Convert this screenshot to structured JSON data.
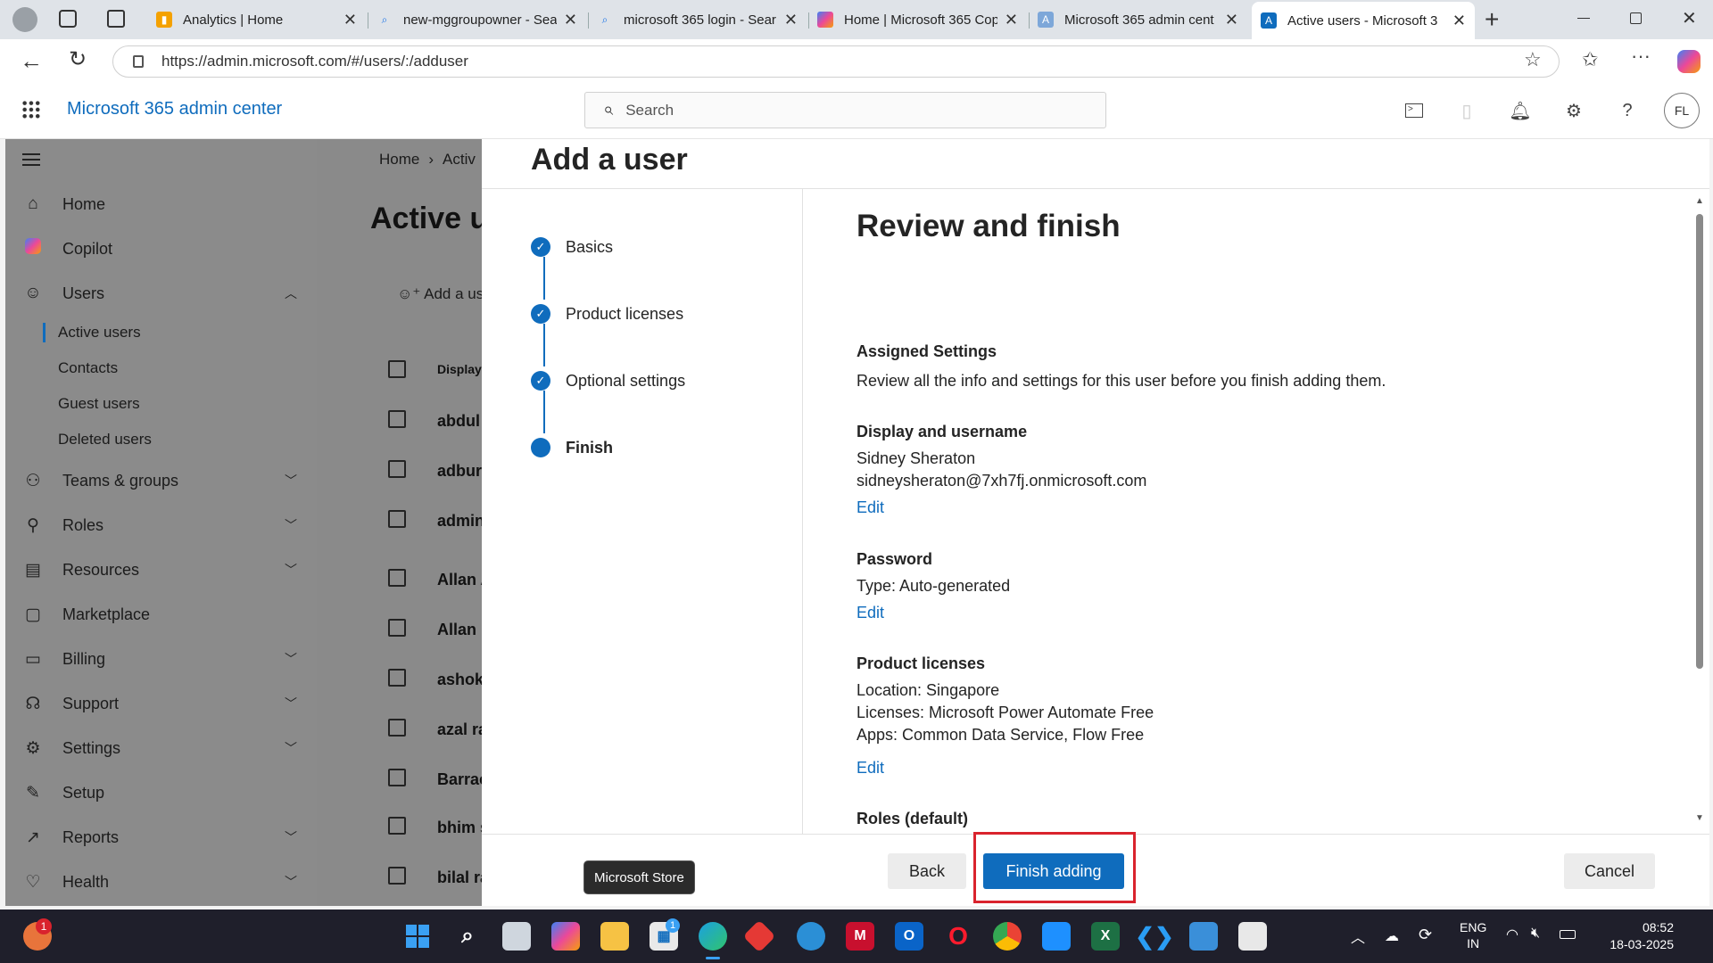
{
  "browser": {
    "tabs": [
      {
        "title": "Analytics | Home",
        "icon": "analytics-icon",
        "color": "#f4a100"
      },
      {
        "title": "new-mggroupowner - Sea",
        "icon": "search-icon",
        "color": "#1a73e8"
      },
      {
        "title": "microsoft 365 login - Sear",
        "icon": "search-icon",
        "color": "#1a73e8"
      },
      {
        "title": "Home | Microsoft 365 Cop",
        "icon": "copilot-icon",
        "color": "#8a5cf6"
      },
      {
        "title": "Microsoft 365 admin cent",
        "icon": "admin-icon",
        "color": "#0f6cbd"
      },
      {
        "title": "Active users - Microsoft 3",
        "icon": "admin-icon",
        "color": "#0f6cbd"
      }
    ],
    "url": "https://admin.microsoft.com/#/users/:/adduser"
  },
  "header": {
    "app_title": "Microsoft 365 admin center",
    "search_placeholder": "Search",
    "avatar_initials": "FL"
  },
  "nav": {
    "items": [
      {
        "label": "Home",
        "icon": "home-icon"
      },
      {
        "label": "Copilot",
        "icon": "copilot-icon"
      },
      {
        "label": "Users",
        "icon": "user-icon"
      },
      {
        "label": "Teams & groups",
        "icon": "teams-icon"
      },
      {
        "label": "Roles",
        "icon": "roles-icon"
      },
      {
        "label": "Resources",
        "icon": "resources-icon"
      },
      {
        "label": "Marketplace",
        "icon": "marketplace-icon"
      },
      {
        "label": "Billing",
        "icon": "billing-icon"
      },
      {
        "label": "Support",
        "icon": "support-icon"
      },
      {
        "label": "Settings",
        "icon": "settings-icon"
      },
      {
        "label": "Setup",
        "icon": "setup-icon"
      },
      {
        "label": "Reports",
        "icon": "reports-icon"
      },
      {
        "label": "Health",
        "icon": "health-icon"
      }
    ],
    "users_sub": [
      "Active users",
      "Contacts",
      "Guest users",
      "Deleted users"
    ]
  },
  "bg_page": {
    "breadcrumb_home": "Home",
    "breadcrumb_current": "Activ",
    "title": "Active u",
    "add_user": "Add a user",
    "col_display": "Display",
    "rows": [
      "abdul",
      "adbur",
      "admin",
      "Allan A",
      "Allan D",
      "ashok",
      "azal ra",
      "Barrac",
      "bhim s",
      "bilal ra"
    ]
  },
  "panel": {
    "title": "Add a user",
    "steps": [
      "Basics",
      "Product licenses",
      "Optional settings",
      "Finish"
    ],
    "heading": "Review and finish",
    "assigned_title": "Assigned Settings",
    "assigned_desc": "Review all the info and settings for this user before you finish adding them.",
    "display_title": "Display and username",
    "display_name": "Sidney Sheraton",
    "username": "sidneysheraton@7xh7fj.onmicrosoft.com",
    "password_title": "Password",
    "password_type": "Type: Auto-generated",
    "licenses_title": "Product licenses",
    "location": "Location: Singapore",
    "licenses": "Licenses: Microsoft Power Automate Free",
    "apps": "Apps: Common Data Service, Flow Free",
    "roles_title": "Roles (default)",
    "edit": "Edit",
    "back": "Back",
    "finish": "Finish adding",
    "cancel": "Cancel",
    "tooltip": "Microsoft Store"
  },
  "taskbar": {
    "lang1": "ENG",
    "lang2": "IN",
    "time": "08:52",
    "date": "18-03-2025",
    "store_badge": "1",
    "notif_badge": "1"
  }
}
